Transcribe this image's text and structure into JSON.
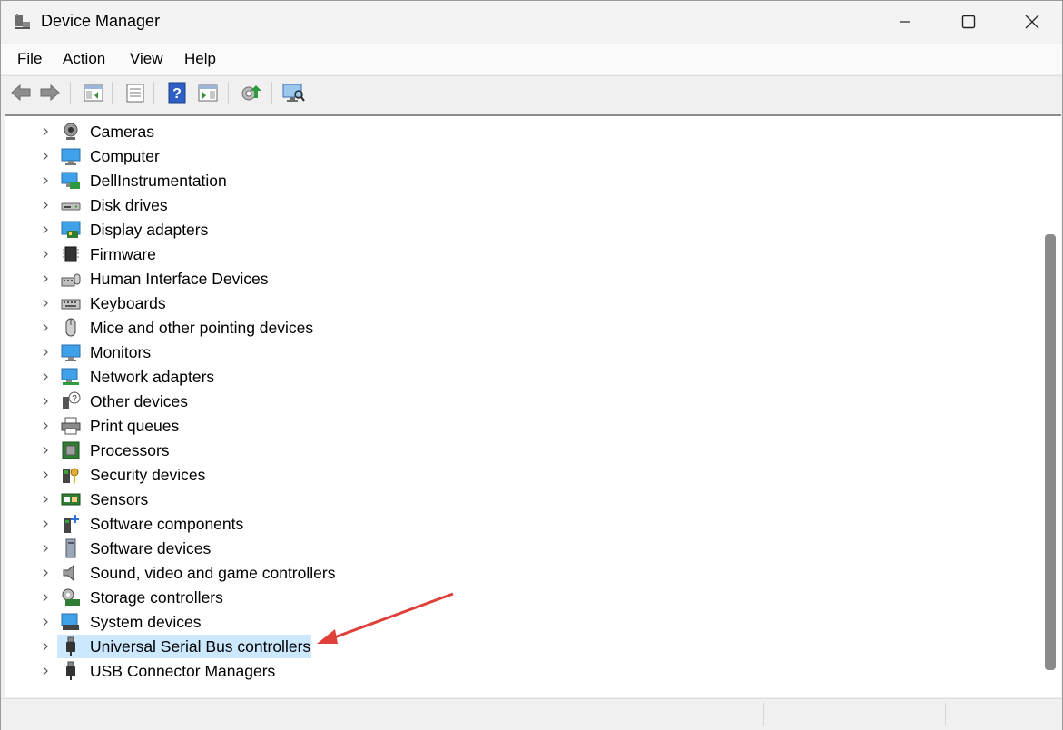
{
  "window": {
    "title": "Device Manager",
    "controls": [
      "minimize",
      "maximize",
      "close"
    ]
  },
  "menu": {
    "items": [
      {
        "label": "File"
      },
      {
        "label": "Action"
      },
      {
        "label": "View"
      },
      {
        "label": "Help"
      }
    ]
  },
  "toolbar": {
    "buttons": [
      "back-icon",
      "forward-icon",
      "show-hide-console-tree-icon",
      "properties-icon",
      "help-icon",
      "action-pane-icon",
      "update-driver-icon",
      "scan-hardware-icon"
    ]
  },
  "tree": {
    "items": [
      {
        "label": "Cameras",
        "icon": "camera-icon"
      },
      {
        "label": "Computer",
        "icon": "computer-icon"
      },
      {
        "label": "DellInstrumentation",
        "icon": "network-monitor-icon"
      },
      {
        "label": "Disk drives",
        "icon": "disk-drive-icon"
      },
      {
        "label": "Display adapters",
        "icon": "display-adapter-icon"
      },
      {
        "label": "Firmware",
        "icon": "chip-icon"
      },
      {
        "label": "Human Interface Devices",
        "icon": "hid-icon"
      },
      {
        "label": "Keyboards",
        "icon": "keyboard-icon"
      },
      {
        "label": "Mice and other pointing devices",
        "icon": "mouse-icon"
      },
      {
        "label": "Monitors",
        "icon": "monitor-icon"
      },
      {
        "label": "Network adapters",
        "icon": "network-adapter-icon"
      },
      {
        "label": "Other devices",
        "icon": "unknown-device-icon"
      },
      {
        "label": "Print queues",
        "icon": "printer-icon"
      },
      {
        "label": "Processors",
        "icon": "processor-icon"
      },
      {
        "label": "Security devices",
        "icon": "security-key-icon"
      },
      {
        "label": "Sensors",
        "icon": "sensor-icon"
      },
      {
        "label": "Software components",
        "icon": "software-component-icon"
      },
      {
        "label": "Software devices",
        "icon": "software-device-icon"
      },
      {
        "label": "Sound, video and game controllers",
        "icon": "speaker-icon"
      },
      {
        "label": "Storage controllers",
        "icon": "storage-controller-icon"
      },
      {
        "label": "System devices",
        "icon": "system-device-icon"
      },
      {
        "label": "Universal Serial Bus controllers",
        "icon": "usb-icon",
        "selected": true
      },
      {
        "label": "USB Connector Managers",
        "icon": "usb-icon"
      }
    ]
  },
  "colors": {
    "selection": "#cce8ff",
    "annotation_arrow": "#e0403a",
    "accent_blue": "#2f6fd6"
  }
}
